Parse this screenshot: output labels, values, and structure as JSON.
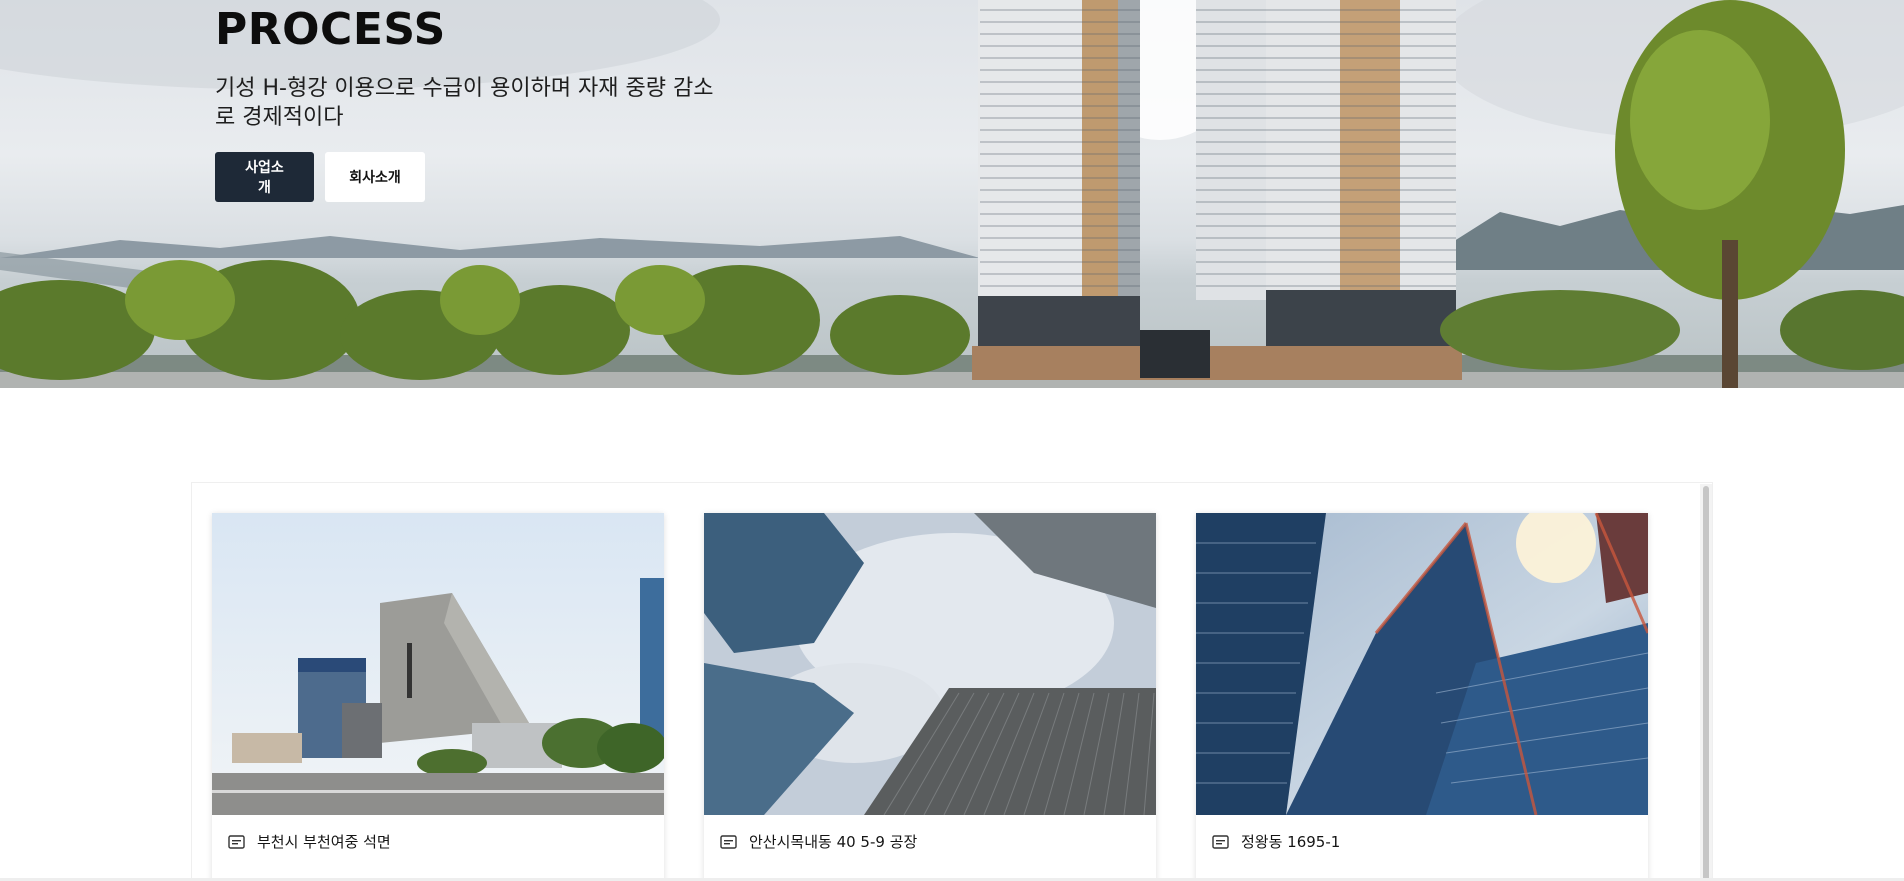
{
  "hero": {
    "title": "PROCESS",
    "subtitle": "기성 H-형강 이용으로 수급이 용이하며 자재 중량 감소로 경제적이다",
    "primary_button": "사업소개",
    "secondary_button": "회사소개"
  },
  "portfolio": {
    "cards": [
      {
        "caption": "부천시 부천여중 석면",
        "icon": "id-card-icon"
      },
      {
        "caption": "안산시목내동 40 5-9 공장",
        "icon": "id-card-icon"
      },
      {
        "caption": "정왕동 1695-1",
        "icon": "id-card-icon"
      }
    ]
  },
  "colors": {
    "primary_button_bg": "#1e2937",
    "secondary_button_bg": "#ffffff"
  }
}
